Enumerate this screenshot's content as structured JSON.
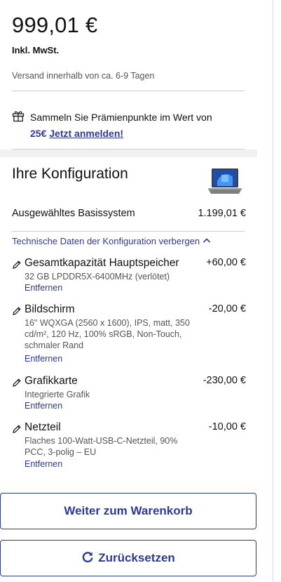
{
  "summary": {
    "price": "999,01 €",
    "vat_note": "Inkl. MwSt.",
    "shipping": "Versand innerhalb von ca. 6-9 Tagen"
  },
  "rewards": {
    "text_line1": "Sammeln Sie Prämienpunkte im Wert von",
    "amount": "25€",
    "register_link": "Jetzt anmelden!",
    "icon": "gift-icon"
  },
  "config": {
    "title": "Ihre Konfiguration",
    "thumbnail": "laptop-thumbnail",
    "base_label": "Ausgewähltes Basissystem",
    "base_price": "1.199,01 €",
    "tech_toggle": "Technische Daten der Konfiguration verbergen",
    "remove_label": "Entfernen",
    "items": [
      {
        "name": "Gesamtkapazität Hauptspeicher",
        "price": "+60,00 €",
        "desc": "32 GB LPDDR5X-6400MHz (verlötet)"
      },
      {
        "name": "Bildschirm",
        "price": "-20,00 €",
        "desc": "16\" WQXGA (2560 x 1600), IPS, matt, 350 cd/m², 120 Hz, 100% sRGB, Non-Touch, schmaler Rand"
      },
      {
        "name": "Grafikkarte",
        "price": "-230,00 €",
        "desc": "Integrierte Grafik"
      },
      {
        "name": "Netzteil",
        "price": "-10,00 €",
        "desc": "Flaches 100-Watt-USB-C-Netzteil, 90% PCC, 3-polig – EU"
      }
    ]
  },
  "actions": {
    "cart_button": "Weiter zum Warenkorb",
    "reset_button": "Zurücksetzen"
  },
  "colors": {
    "accent": "#2f3a8f",
    "muted_text": "#555555",
    "divider": "#cfcfcf"
  }
}
